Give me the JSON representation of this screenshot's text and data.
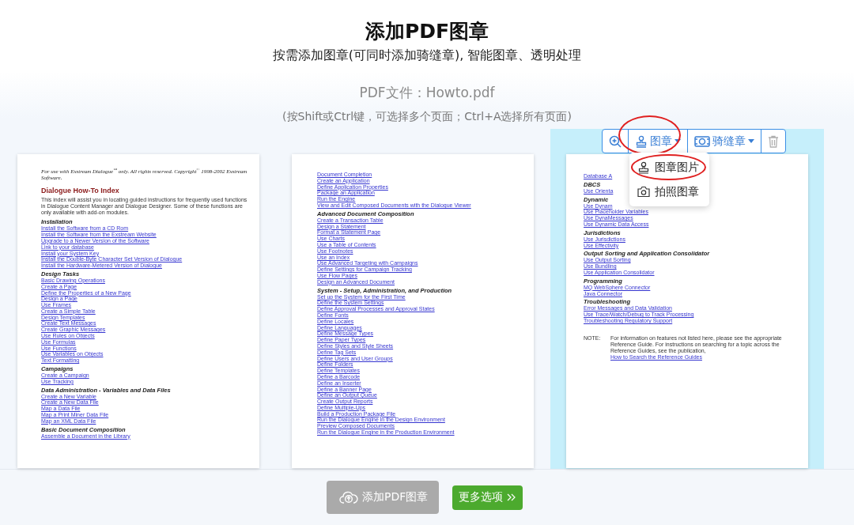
{
  "header": {
    "title": "添加PDF图章",
    "subtitle": "按需添加图章(可同时添加骑缝章), 智能图章、透明处理"
  },
  "file_label": "PDF文件：Howto.pdf",
  "hint": "(按Shift或Ctrl键，可选择多个页面；Ctrl+A选择所有页面)",
  "pages": [
    {
      "selected": false,
      "blocks": [
        {
          "kind": "header",
          "text": "For use with Exstream Dialogue$^{™}$ only. All rights reserved. Copyright$^{©}$ 1998-2002 Exstream Software."
        },
        {
          "kind": "title",
          "text": "Dialogue How-To Index"
        },
        {
          "kind": "paragraph",
          "text": "This index will assist you in locating guided instructions for frequently used functions in Dialogue Content Manager and Dialogue Designer. Some of these functions are only available with add-on modules."
        },
        {
          "kind": "heading",
          "text": "Installation"
        },
        {
          "kind": "link",
          "text": "Install the Software from a CD Rom"
        },
        {
          "kind": "link",
          "text": "Install the Software from the Exstream Website"
        },
        {
          "kind": "link",
          "text": "Upgrade to a Newer Version of the Software"
        },
        {
          "kind": "link",
          "text": "Link to your database"
        },
        {
          "kind": "link",
          "text": "Install your System Key"
        },
        {
          "kind": "link",
          "text": "Install the Double-Byte Character Set Version of Dialogue"
        },
        {
          "kind": "link",
          "text": "Install the Hardware-Metered Version of Dialogue"
        },
        {
          "kind": "heading",
          "text": "Design Tasks"
        },
        {
          "kind": "link",
          "text": "Basic Drawing Operations"
        },
        {
          "kind": "link",
          "text": "Create a Page"
        },
        {
          "kind": "link",
          "text": "Define the Properties of a New Page"
        },
        {
          "kind": "link",
          "text": "Design a Page"
        },
        {
          "kind": "link",
          "text": "Use Frames"
        },
        {
          "kind": "link",
          "text": "Create a Simple Table"
        },
        {
          "kind": "link",
          "text": "Design Templates"
        },
        {
          "kind": "link",
          "text": "Create Text Messages"
        },
        {
          "kind": "link",
          "text": "Create Graphic Messages"
        },
        {
          "kind": "link",
          "text": "Use Rules on Objects"
        },
        {
          "kind": "link",
          "text": "Use Formulas"
        },
        {
          "kind": "link",
          "text": "Use Functions"
        },
        {
          "kind": "link",
          "text": "Use Variables on Objects"
        },
        {
          "kind": "link",
          "text": "Text Formatting"
        },
        {
          "kind": "heading",
          "text": "Campaigns"
        },
        {
          "kind": "link",
          "text": "Create a Campaign"
        },
        {
          "kind": "link",
          "text": "Use Tracking"
        },
        {
          "kind": "heading",
          "text": "Data Administration - Variables and Data Files"
        },
        {
          "kind": "link",
          "text": "Create a New Variable"
        },
        {
          "kind": "link",
          "text": "Create a New Data File"
        },
        {
          "kind": "link",
          "text": "Map a Data File"
        },
        {
          "kind": "link",
          "text": "Map a Print Miner Data File"
        },
        {
          "kind": "link",
          "text": "Map an XML Data File"
        },
        {
          "kind": "heading",
          "text": "Basic Document Composition"
        },
        {
          "kind": "link",
          "text": "Assemble a Document in the Library"
        }
      ]
    },
    {
      "selected": false,
      "blocks": [
        {
          "kind": "link",
          "text": "Document Completion"
        },
        {
          "kind": "link",
          "text": "Create an Application"
        },
        {
          "kind": "link",
          "text": "Define Application Properties"
        },
        {
          "kind": "link",
          "text": "Package an Application"
        },
        {
          "kind": "link",
          "text": "Run the Engine"
        },
        {
          "kind": "link",
          "text": "View and Edit Composed Documents with the Dialogue Viewer"
        },
        {
          "kind": "heading",
          "text": "Advanced Document Composition"
        },
        {
          "kind": "link",
          "text": "Create a Transaction Table"
        },
        {
          "kind": "link",
          "text": "Design a Statement"
        },
        {
          "kind": "link",
          "text": "Format a Statement Page"
        },
        {
          "kind": "link",
          "text": "Use Charts"
        },
        {
          "kind": "link",
          "text": "Use a Table of Contents"
        },
        {
          "kind": "link",
          "text": "Use Footnotes"
        },
        {
          "kind": "link",
          "text": "Use an Index"
        },
        {
          "kind": "link",
          "text": "Use Advanced Targeting with Campaigns"
        },
        {
          "kind": "link",
          "text": "Define Settings for Campaign Tracking"
        },
        {
          "kind": "link",
          "text": "Use Flow Pages"
        },
        {
          "kind": "link",
          "text": "Design an Advanced Document"
        },
        {
          "kind": "heading",
          "text": "System - Setup, Administration, and Production"
        },
        {
          "kind": "link",
          "text": "Set up the System for the First Time"
        },
        {
          "kind": "link",
          "text": "Define the System Settings"
        },
        {
          "kind": "link",
          "text": "Define Approval Processes and Approval States"
        },
        {
          "kind": "link",
          "text": "Define Fonts"
        },
        {
          "kind": "link",
          "text": "Define Locales"
        },
        {
          "kind": "link",
          "text": "Define Languages"
        },
        {
          "kind": "link",
          "text": "Define Message Types"
        },
        {
          "kind": "link",
          "text": "Define Paper Types"
        },
        {
          "kind": "link",
          "text": "Define Styles and Style Sheets"
        },
        {
          "kind": "link",
          "text": "Define Tag Sets"
        },
        {
          "kind": "link",
          "text": "Define Users and User Groups"
        },
        {
          "kind": "link",
          "text": "Define Folders"
        },
        {
          "kind": "link",
          "text": "Define Templates"
        },
        {
          "kind": "link",
          "text": "Define a Barcode"
        },
        {
          "kind": "link",
          "text": "Define an Inserter"
        },
        {
          "kind": "link",
          "text": "Define a Banner Page"
        },
        {
          "kind": "link",
          "text": "Define an Output Queue"
        },
        {
          "kind": "link",
          "text": "Create Output Reports"
        },
        {
          "kind": "link",
          "text": "Define Multiple-Ups"
        },
        {
          "kind": "link",
          "text": "Build a Production Package File"
        },
        {
          "kind": "link",
          "text": "Run the Dialogue Engine in the Design Environment"
        },
        {
          "kind": "link",
          "text": "Preview Composed Documents"
        },
        {
          "kind": "link",
          "text": "Run the Dialogue Engine in the Production Environment"
        }
      ]
    },
    {
      "selected": true,
      "blocks": [
        {
          "kind": "link",
          "text": "Database A"
        },
        {
          "kind": "heading",
          "text": "DBCS"
        },
        {
          "kind": "link",
          "text": "Use Orienta"
        },
        {
          "kind": "heading",
          "text": "Dynamic"
        },
        {
          "kind": "link",
          "text": "Use Dynam"
        },
        {
          "kind": "link",
          "text": "Use Placeholder Variables"
        },
        {
          "kind": "link",
          "text": "Use DynaMessages"
        },
        {
          "kind": "link",
          "text": "Use Dynamic Data Access"
        },
        {
          "kind": "heading",
          "text": "Jurisdictions"
        },
        {
          "kind": "link",
          "text": "Use Jurisdictions"
        },
        {
          "kind": "link",
          "text": "Use Effectivity"
        },
        {
          "kind": "heading",
          "text": "Output Sorting and Application Consolidator"
        },
        {
          "kind": "link",
          "text": "Use Output Sorting"
        },
        {
          "kind": "link",
          "text": "Use Bundling"
        },
        {
          "kind": "link",
          "text": "Use Application Consolidator"
        },
        {
          "kind": "heading",
          "text": "Programming"
        },
        {
          "kind": "link",
          "text": "MQ WebSphere Connector"
        },
        {
          "kind": "link",
          "text": "Java Connector"
        },
        {
          "kind": "heading",
          "text": "Troubleshooting"
        },
        {
          "kind": "link",
          "text": "Error Messages and Data Validation"
        },
        {
          "kind": "link",
          "text": "Use Trace/Watch/Debug to Track Processing"
        },
        {
          "kind": "link",
          "text": "Troubleshooting Regulatory Support"
        },
        {
          "kind": "note",
          "label": "NOTE:",
          "text": "For information on features not listed here, please see the appropriate Reference Guide. For instructions on searching for a topic across the Reference Guides, see the publication, ",
          "link": "How to Search the Reference Guides"
        }
      ]
    }
  ],
  "toolbar": {
    "buttons": [
      {
        "kind": "zoom",
        "circled": false
      },
      {
        "kind": "stamp",
        "label": "图章",
        "circled": true
      },
      {
        "kind": "seam",
        "label": "骑缝章",
        "circled": false
      },
      {
        "kind": "delete",
        "circled": false
      }
    ]
  },
  "menu": {
    "items": [
      {
        "kind": "image",
        "label": "图章图片",
        "circled": true
      },
      {
        "kind": "camera",
        "label": "拍照图章",
        "circled": false
      }
    ]
  },
  "footer": {
    "buttons": [
      {
        "kind": "upload",
        "label": "添加PDF图章",
        "disabled": true
      },
      {
        "kind": "more",
        "label": "更多选项",
        "disabled": false
      }
    ]
  }
}
